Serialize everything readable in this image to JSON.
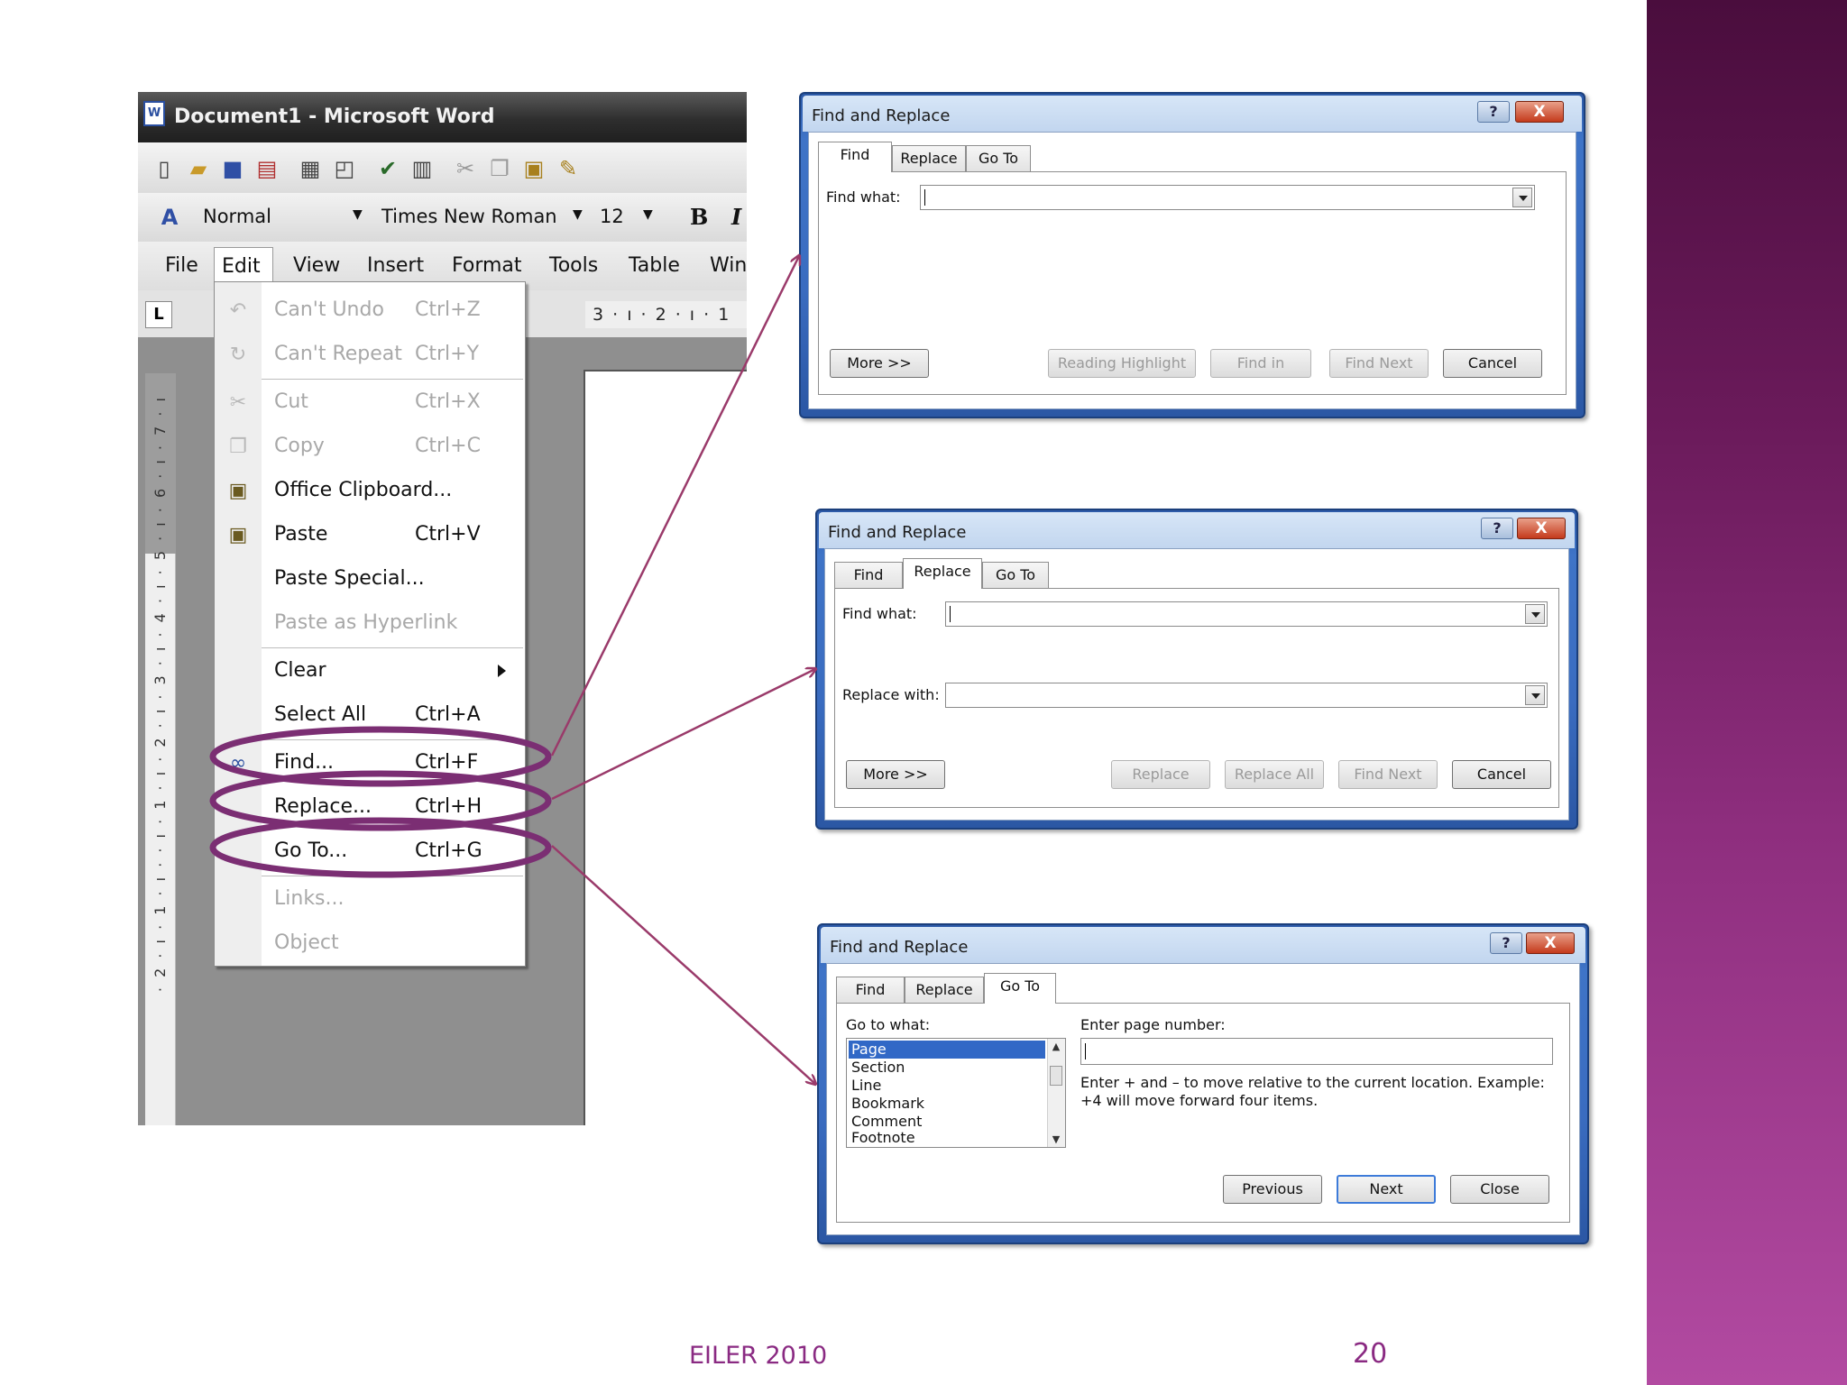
{
  "slide": {
    "footer": "EILER 2010",
    "page_number": "20",
    "side_band_color": "#7a1f6a"
  },
  "word": {
    "title": "Document1 - Microsoft Word",
    "app_icon": "W",
    "style_box": "Normal",
    "font_box": "Times New Roman",
    "size_box": "12",
    "bold": "B",
    "italic": "I",
    "menus": [
      "File",
      "Edit",
      "View",
      "Insert",
      "Format",
      "Tools",
      "Table",
      "Win"
    ],
    "ruler_tab": "L",
    "ruler_text": "3 · ı · 2 · ı · 1",
    "vertical_ruler_text": "· 2 · ı · 1 · ı ·  · ı · 1 · ı · 2 · ı · 3 · ı · 4 · ı · 5 · ı · 6 · ı · 7 · ı"
  },
  "edit_menu": {
    "items": [
      {
        "label": "Can't Undo",
        "shortcut": "Ctrl+Z",
        "icon": "undo-icon"
      },
      {
        "label": "Can't Repeat",
        "shortcut": "Ctrl+Y",
        "icon": "repeat-icon"
      },
      {
        "label": "Cut",
        "shortcut": "Ctrl+X",
        "icon": "cut-icon"
      },
      {
        "label": "Copy",
        "shortcut": "Ctrl+C",
        "icon": "copy-icon"
      },
      {
        "label": "Office Clipboard...",
        "shortcut": "",
        "icon": "clipboard-icon"
      },
      {
        "label": "Paste",
        "shortcut": "Ctrl+V",
        "icon": "paste-icon"
      },
      {
        "label": "Paste Special...",
        "shortcut": "",
        "icon": ""
      },
      {
        "label": "Paste as Hyperlink",
        "shortcut": "",
        "icon": ""
      },
      {
        "label": "Clear",
        "shortcut": "",
        "icon": ""
      },
      {
        "label": "Select All",
        "shortcut": "Ctrl+A",
        "icon": ""
      },
      {
        "label": "Find...",
        "shortcut": "Ctrl+F",
        "icon": "binoculars-icon"
      },
      {
        "label": "Replace...",
        "shortcut": "Ctrl+H",
        "icon": ""
      },
      {
        "label": "Go To...",
        "shortcut": "Ctrl+G",
        "icon": ""
      },
      {
        "label": "Links...",
        "shortcut": "",
        "icon": ""
      },
      {
        "label": "Object",
        "shortcut": "",
        "icon": ""
      }
    ]
  },
  "find_dialog": {
    "title": "Find and Replace",
    "help": "?",
    "close": "X",
    "tabs": [
      "Find",
      "Replace",
      "Go To"
    ],
    "find_label": "Find what:",
    "buttons": {
      "more": "More >>",
      "reading": "Reading Highlight",
      "find_in": "Find in",
      "find_next": "Find Next",
      "cancel": "Cancel"
    }
  },
  "replace_dialog": {
    "title": "Find and Replace",
    "help": "?",
    "close": "X",
    "tabs": [
      "Find",
      "Replace",
      "Go To"
    ],
    "find_label": "Find what:",
    "replace_label": "Replace with:",
    "buttons": {
      "more": "More >>",
      "replace": "Replace",
      "replace_all": "Replace All",
      "find_next": "Find Next",
      "cancel": "Cancel"
    }
  },
  "goto_dialog": {
    "title": "Find and Replace",
    "help": "?",
    "close": "X",
    "tabs": [
      "Find",
      "Replace",
      "Go To"
    ],
    "goto_label": "Go to what:",
    "goto_items": [
      "Page",
      "Section",
      "Line",
      "Bookmark",
      "Comment",
      "Footnote"
    ],
    "page_label": "Enter page number:",
    "hint": "Enter + and – to move relative to the current location. Example: +4 will move forward four items.",
    "buttons": {
      "previous": "Previous",
      "next": "Next",
      "close": "Close"
    }
  },
  "annotations": {
    "ellipse_color": "#7b2e73",
    "arrow_color": "#9a3a6a"
  }
}
